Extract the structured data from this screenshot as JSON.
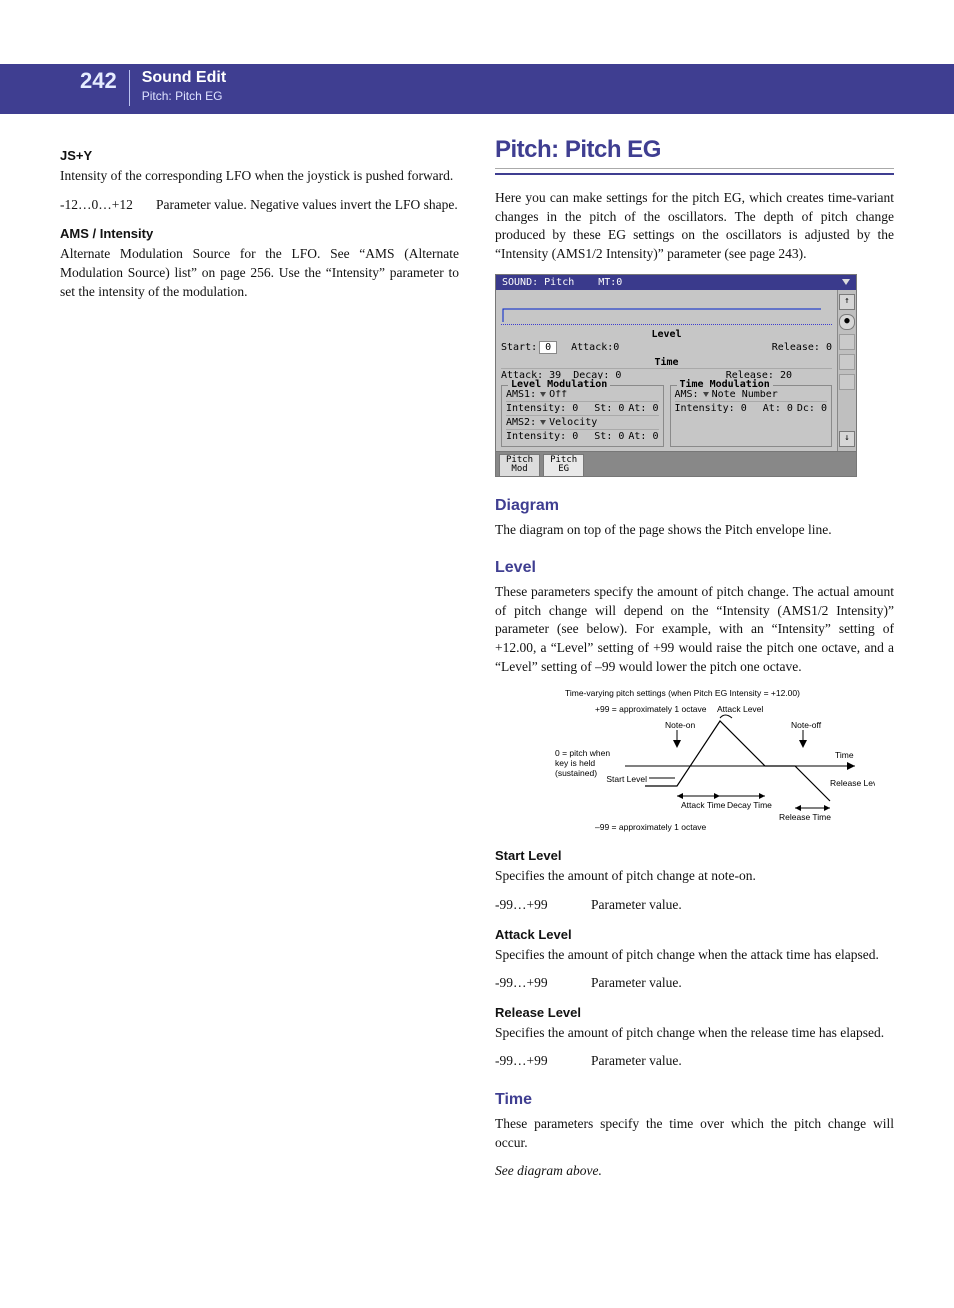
{
  "header": {
    "page_number": "242",
    "title_main": "Sound Edit",
    "title_sub": "Pitch: Pitch EG"
  },
  "left": {
    "h_jsy": "JS+Y",
    "p_jsy": "Intensity of the corresponding LFO when the joystick is pushed forward.",
    "param_jsy_key": "-12…0…+12",
    "param_jsy_val": "Parameter value. Negative values invert the LFO shape.",
    "h_ams": "AMS / Intensity",
    "p_ams": "Alternate Modulation Source for the LFO. See “AMS (Alternate Modulation Source) list” on page 256. Use the “Intensity” parameter to set the intensity of the modulation."
  },
  "right": {
    "section_title": "Pitch: Pitch EG",
    "intro": "Here you can make settings for the pitch EG, which creates time-variant changes in the pitch of the oscillators. The depth of pitch change produced by these EG settings on the oscillators is adjusted by the “Intensity (AMS1/2 Intensity)” parameter (see page 243).",
    "diagram_h": "Diagram",
    "diagram_p": "The diagram on top of the page shows the Pitch envelope line.",
    "level_h": "Level",
    "level_p": "These parameters specify the amount of pitch change. The actual amount of pitch change will depend on the “Intensity (AMS1/2 Intensity)” parameter (see below). For example, with an “Intensity” setting of +12.00, a “Level” setting of +99 would raise the pitch one octave, and a “Level” setting of –99 would lower the pitch one octave.",
    "start_h": "Start Level",
    "start_p": "Specifies the amount of pitch change at note-on.",
    "param99_key": "-99…+99",
    "param99_val": "Parameter value.",
    "attack_h": "Attack Level",
    "attack_p": "Specifies the amount of pitch change when the attack time has elapsed.",
    "release_h": "Release Level",
    "release_p": "Specifies the amount of pitch change when the release time has elapsed.",
    "time_h": "Time",
    "time_p": "These parameters specify the time over which the pitch change will occur.",
    "time_see": "See diagram above."
  },
  "ui": {
    "title": "SOUND: Pitch",
    "mt": "MT:0",
    "level_label": "Level",
    "time_label": "Time",
    "start_lbl": "Start:",
    "start_val": "0",
    "attack_lbl": "Attack:0",
    "release_lbl": "Release: 0",
    "attack2_lbl": "Attack: 39",
    "decay_lbl": "Decay: 0",
    "release2_lbl": "Release: 20",
    "lm_title": "Level Modulation",
    "tm_title": "Time Modulation",
    "ams1_lbl": "AMS1:",
    "ams1_val": "Off",
    "lm_int_lbl": "Intensity: 0",
    "lm_st_lbl": "St: 0",
    "lm_at_lbl": "At: 0",
    "ams2_lbl": "AMS2:",
    "ams2_val": "Velocity",
    "lm2_int_lbl": "Intensity: 0",
    "lm2_st_lbl": "St: 0",
    "lm2_at_lbl": "At: 0",
    "tm_ams_lbl": "AMS:",
    "tm_ams_val": "Note Number",
    "tm_int_lbl": "Intensity: 0",
    "tm_at_lbl": "At: 0",
    "tm_dc_lbl": "Dc: 0",
    "tab1a": "Pitch",
    "tab1b": "Mod",
    "tab2a": "Pitch",
    "tab2b": "EG",
    "side_up": "↑",
    "side_down": "↓",
    "side_dot": "●"
  },
  "env": {
    "caption": "Time-varying pitch settings (when Pitch EG Intensity = +12.00)",
    "plus99": "+99 = approximately 1 octave",
    "minus99": "–99 = approximately 1 octave",
    "zero_a": "0 = pitch when",
    "zero_b": "key is held",
    "zero_c": "(sustained)",
    "note_on": "Note-on",
    "note_off": "Note-off",
    "attack_level": "Attack Level",
    "start_level": "Start Level",
    "attack_time": "Attack Time",
    "decay_time": "Decay Time",
    "release_time": "Release Time",
    "release_level": "Release Level",
    "time_axis": "Time"
  }
}
